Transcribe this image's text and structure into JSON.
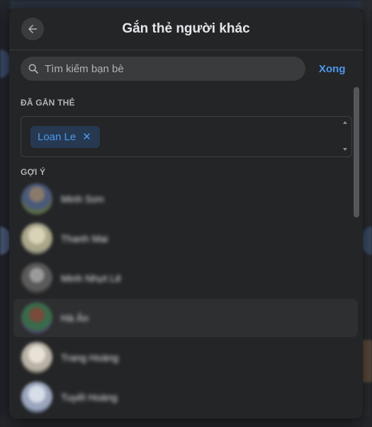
{
  "dialog": {
    "title": "Gắn thẻ người khác",
    "back_icon": "arrow-left-icon",
    "search": {
      "placeholder": "Tìm kiếm bạn bè",
      "value": "",
      "icon": "search-icon"
    },
    "done_label": "Xong",
    "tagged_section_label": "ĐÃ GẮN THẺ",
    "tagged": [
      {
        "name": "Loan Le",
        "remove_icon": "close-icon"
      }
    ],
    "suggestions_label": "GỢI Ý",
    "suggestions": [
      {
        "name": "Minh Sơn",
        "blurred": true
      },
      {
        "name": "Thanh Mai",
        "blurred": true
      },
      {
        "name": "Minh Nhựt Lê",
        "blurred": true
      },
      {
        "name": "Hà Ân",
        "blurred": true
      },
      {
        "name": "Trang Hoàng",
        "blurred": true
      },
      {
        "name": "Tuyết Hoàng",
        "blurred": true
      }
    ]
  },
  "colors": {
    "dialog_bg": "#242526",
    "accent": "#4b98ee",
    "chip_bg": "#263951",
    "text_primary": "#e4e6eb",
    "text_secondary": "#b0b3b8"
  }
}
